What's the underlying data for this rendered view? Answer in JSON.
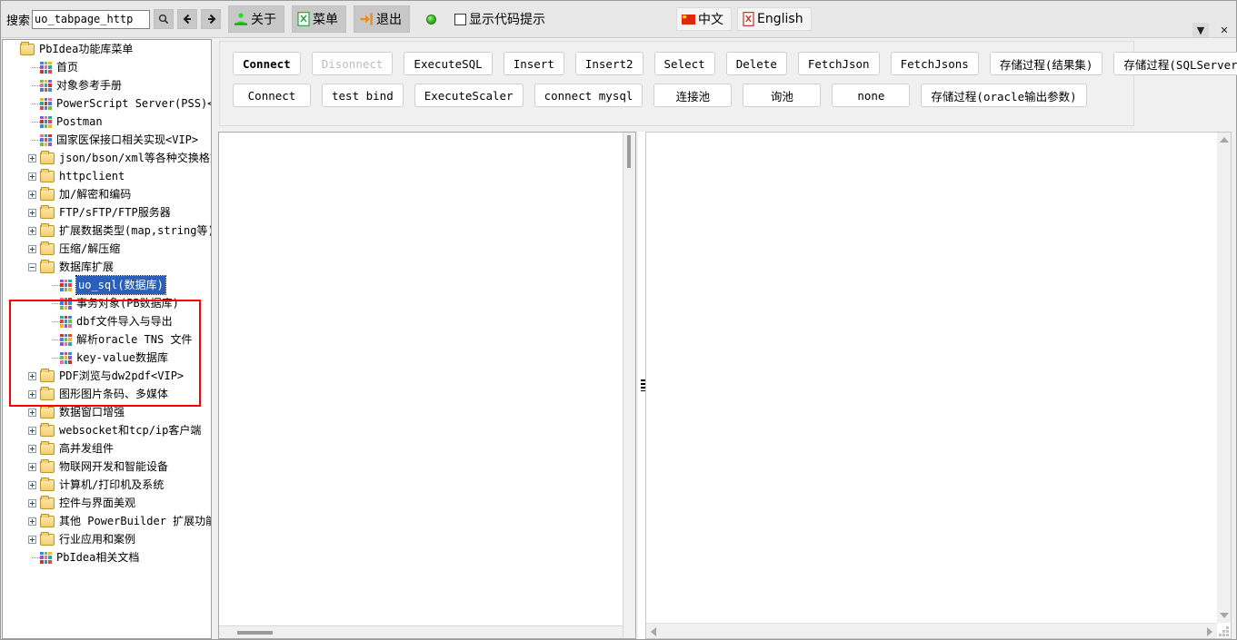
{
  "toolbar": {
    "search_label": "搜索",
    "search_value": "uo_tabpage_http",
    "search_placeholder": "",
    "search_icon": "search-icon",
    "back_icon": "arrow-left-icon",
    "forward_icon": "arrow-right-icon",
    "about_label": "关于",
    "menu_label": "菜单",
    "exit_label": "退出",
    "status_dot": "green-status-indicator",
    "checkbox_label": "显示代码提示",
    "checkbox_checked": false,
    "lang_cn_label": "中文",
    "lang_en_label": "English",
    "win_dropdown": "▼",
    "win_close": "✕"
  },
  "sidebar": {
    "nodes": [
      {
        "label": "PbIdea功能库菜单",
        "depth": 0,
        "icon": "folder",
        "toggle": "none",
        "selected": false
      },
      {
        "label": "首页",
        "depth": 1,
        "icon": "grid",
        "toggle": "none",
        "selected": false
      },
      {
        "label": "对象参考手册",
        "depth": 1,
        "icon": "grid",
        "toggle": "none",
        "selected": false
      },
      {
        "label": "PowerScript Server(PSS)<VIP>",
        "depth": 1,
        "icon": "grid",
        "toggle": "none",
        "selected": false
      },
      {
        "label": "Postman",
        "depth": 1,
        "icon": "grid",
        "toggle": "none",
        "selected": false
      },
      {
        "label": "国家医保接口相关实现<VIP>",
        "depth": 1,
        "icon": "grid",
        "toggle": "none",
        "selected": false
      },
      {
        "label": "json/bson/xml等各种交换格式",
        "depth": 1,
        "icon": "folder",
        "toggle": "plus",
        "selected": false
      },
      {
        "label": "httpclient",
        "depth": 1,
        "icon": "folder",
        "toggle": "plus",
        "selected": false
      },
      {
        "label": "加/解密和编码",
        "depth": 1,
        "icon": "folder",
        "toggle": "plus",
        "selected": false
      },
      {
        "label": "FTP/sFTP/FTP服务器",
        "depth": 1,
        "icon": "folder",
        "toggle": "plus",
        "selected": false
      },
      {
        "label": "扩展数据类型(map,string等)",
        "depth": 1,
        "icon": "folder",
        "toggle": "plus",
        "selected": false
      },
      {
        "label": "压缩/解压缩",
        "depth": 1,
        "icon": "folder",
        "toggle": "plus",
        "selected": false
      },
      {
        "label": "数据库扩展",
        "depth": 1,
        "icon": "folder",
        "toggle": "minus",
        "selected": false
      },
      {
        "label": "uo_sql(数据库)",
        "depth": 2,
        "icon": "grid",
        "toggle": "none",
        "selected": true
      },
      {
        "label": "事务对象(PB数据库)",
        "depth": 2,
        "icon": "grid",
        "toggle": "none",
        "selected": false
      },
      {
        "label": "dbf文件导入与导出",
        "depth": 2,
        "icon": "grid",
        "toggle": "none",
        "selected": false
      },
      {
        "label": "解析oracle TNS 文件",
        "depth": 2,
        "icon": "grid",
        "toggle": "none",
        "selected": false
      },
      {
        "label": "key-value数据库",
        "depth": 2,
        "icon": "grid",
        "toggle": "none",
        "selected": false
      },
      {
        "label": "PDF浏览与dw2pdf<VIP>",
        "depth": 1,
        "icon": "folder",
        "toggle": "plus",
        "selected": false
      },
      {
        "label": "图形图片条码、多媒体",
        "depth": 1,
        "icon": "folder",
        "toggle": "plus",
        "selected": false
      },
      {
        "label": "数据窗口增强",
        "depth": 1,
        "icon": "folder",
        "toggle": "plus",
        "selected": false
      },
      {
        "label": "websocket和tcp/ip客户端",
        "depth": 1,
        "icon": "folder",
        "toggle": "plus",
        "selected": false
      },
      {
        "label": "高并发组件",
        "depth": 1,
        "icon": "folder",
        "toggle": "plus",
        "selected": false
      },
      {
        "label": "物联网开发和智能设备",
        "depth": 1,
        "icon": "folder",
        "toggle": "plus",
        "selected": false
      },
      {
        "label": "计算机/打印机及系统",
        "depth": 1,
        "icon": "folder",
        "toggle": "plus",
        "selected": false
      },
      {
        "label": "控件与界面美观",
        "depth": 1,
        "icon": "folder",
        "toggle": "plus",
        "selected": false
      },
      {
        "label": "其他 PowerBuilder 扩展功能",
        "depth": 1,
        "icon": "folder",
        "toggle": "plus",
        "selected": false
      },
      {
        "label": "行业应用和案例",
        "depth": 1,
        "icon": "folder",
        "toggle": "plus",
        "selected": false
      },
      {
        "label": "PbIdea相关文档",
        "depth": 1,
        "icon": "grid",
        "toggle": "none",
        "selected": false
      }
    ],
    "highlight_color": "#ff0000",
    "selection_color": "#2a5fba"
  },
  "main": {
    "button_rows": [
      [
        {
          "label": "Connect",
          "state": "bold"
        },
        {
          "label": "Disonnect",
          "state": "disabled"
        },
        {
          "label": "ExecuteSQL",
          "state": "normal"
        },
        {
          "label": "Insert",
          "state": "normal"
        },
        {
          "label": "Insert2",
          "state": "normal"
        },
        {
          "label": "Select",
          "state": "normal"
        },
        {
          "label": "Delete",
          "state": "normal"
        },
        {
          "label": "FetchJson",
          "state": "normal"
        },
        {
          "label": "FetchJsons",
          "state": "normal"
        },
        {
          "label": "存储过程(结果集)",
          "state": "normal"
        },
        {
          "label": "存储过程(SQLServer输出参数)",
          "state": "normal"
        }
      ],
      [
        {
          "label": "Connect",
          "state": "normal"
        },
        {
          "label": "test bind",
          "state": "normal"
        },
        {
          "label": "ExecuteScaler",
          "state": "normal"
        },
        {
          "label": "connect mysql",
          "state": "normal"
        },
        {
          "label": "连接池",
          "state": "normal"
        },
        {
          "label": "询池",
          "state": "normal"
        },
        {
          "label": "none",
          "state": "normal"
        },
        {
          "label": "存储过程(oracle输出参数)",
          "state": "normal"
        }
      ]
    ],
    "editor_left_text": "",
    "editor_right_text": "",
    "splitter_icon": "splitter-grip-icon"
  }
}
